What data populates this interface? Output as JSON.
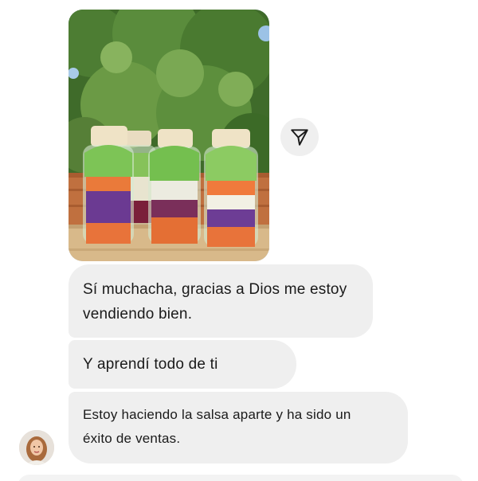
{
  "messages": [
    {
      "text_lines": [
        "Sí muchacha, gracias a Dios me estoy",
        "vendiendo bien."
      ]
    },
    {
      "text_lines": [
        "Y aprendí todo de ti"
      ]
    },
    {
      "text_lines": [
        "Estoy haciendo la salsa aparte y ha sido un",
        "éxito de ventas."
      ]
    }
  ],
  "icons": {
    "share": "share-send-icon",
    "avatar": "user-avatar"
  },
  "colors": {
    "bubble_bg": "#efefef",
    "text": "#1a1a1a"
  }
}
